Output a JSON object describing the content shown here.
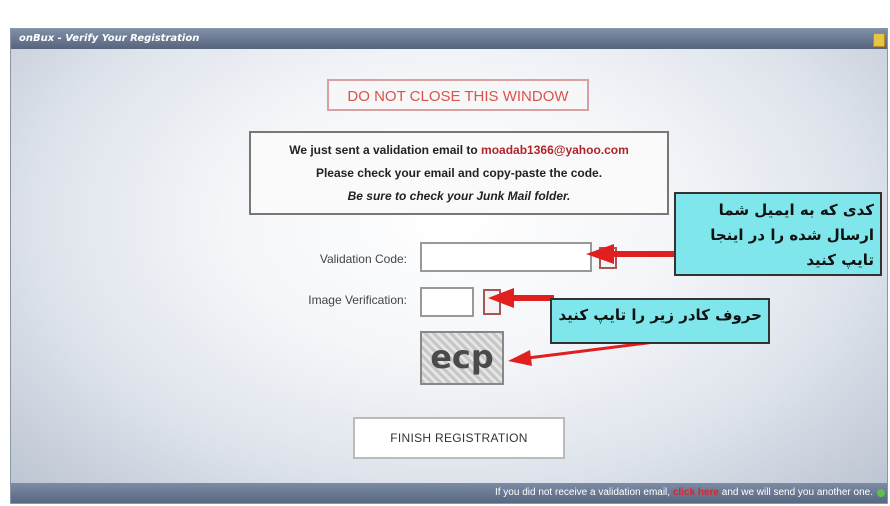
{
  "window": {
    "title": "onBux - Verify Your Registration"
  },
  "warning": "DO NOT CLOSE THIS WINDOW",
  "message": {
    "line1_prefix": "We just sent a validation email to",
    "email": "moadab1366@yahoo.com",
    "line2": "Please check your email and copy-paste the code.",
    "line3": "Be sure to check your Junk Mail folder."
  },
  "form": {
    "validation_label": "Validation Code:",
    "validation_value": "",
    "image_label": "Image Verification:",
    "image_value": "",
    "captcha_text": "ecp",
    "finish_label": "FINISH REGISTRATION"
  },
  "footer": {
    "text_before": "If you did not receive a validation email,",
    "link": "click here",
    "text_after": "and we will send you another one."
  },
  "annotations": {
    "note1": "کدی که به ایمیل شما ارسال شده را در اینجا تایپ کنید",
    "note2": "حروف کادر زیر را تایپ کنید"
  },
  "colors": {
    "annotation_bg": "#7fe6ec",
    "arrow": "#e02020",
    "warning_text": "#d9534f",
    "email_text": "#b0242a"
  }
}
